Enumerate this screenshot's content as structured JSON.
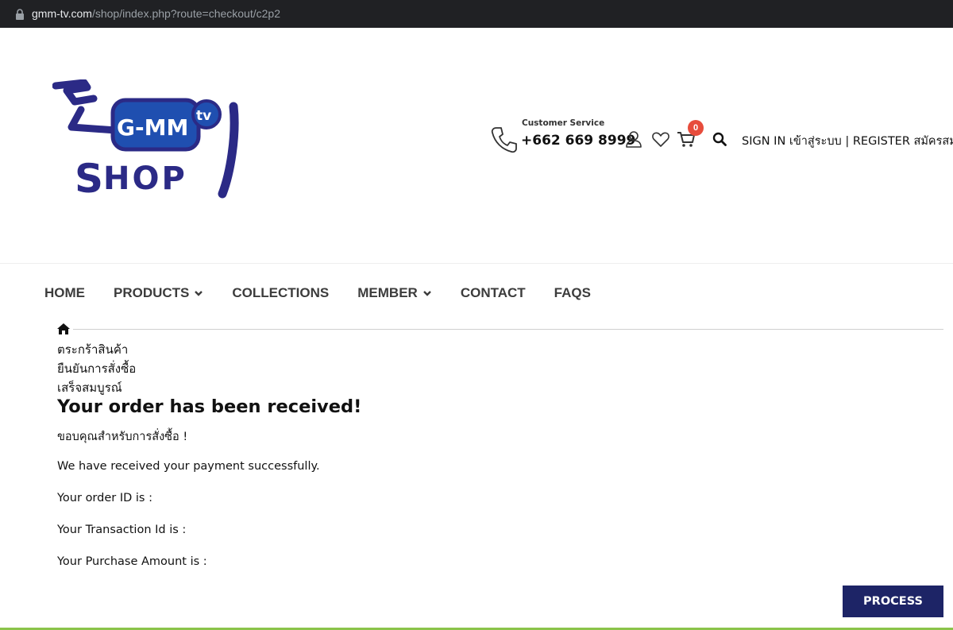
{
  "browser": {
    "url_host": "gmm-tv.com",
    "url_path": "/shop/index.php?route=checkout/c2p2"
  },
  "header": {
    "logo_text_top": "G-MM",
    "logo_text_badge": "tv",
    "logo_text_bottom": "SHOP",
    "customer_service_label": "Customer Service",
    "phone": "+662 669 8999",
    "cart_count": "0",
    "sign_in": "SIGN IN เข้าสู่ระบบ",
    "separator": " | ",
    "register": "REGISTER สมัครสมาชิก"
  },
  "nav": {
    "items": [
      {
        "label": "HOME",
        "dropdown": false
      },
      {
        "label": "PRODUCTS",
        "dropdown": true
      },
      {
        "label": "COLLECTIONS",
        "dropdown": false
      },
      {
        "label": "MEMBER",
        "dropdown": true
      },
      {
        "label": "CONTACT",
        "dropdown": false
      },
      {
        "label": "FAQS",
        "dropdown": false
      }
    ]
  },
  "steps": [
    "ตระกร้าสินค้า",
    "ยืนยันการสั่งซื้อ",
    "เสร็จสมบูรณ์"
  ],
  "main": {
    "title": "Your order has been received!",
    "thanks": "ขอบคุณสำหรับการสั่งซื้อ !",
    "payment_msg": "We have received your payment successfully.",
    "order_id_label": "Your order ID is :",
    "transaction_label": "Your Transaction Id is :",
    "amount_label": "Your Purchase Amount is :",
    "process_button": "PROCESS"
  },
  "colors": {
    "brand_navy": "#1d2466",
    "logo_purple": "#2b2a86",
    "logo_blue": "#1f4fb0",
    "badge_red": "#e74c3c",
    "footer_green": "#8bc34a"
  }
}
